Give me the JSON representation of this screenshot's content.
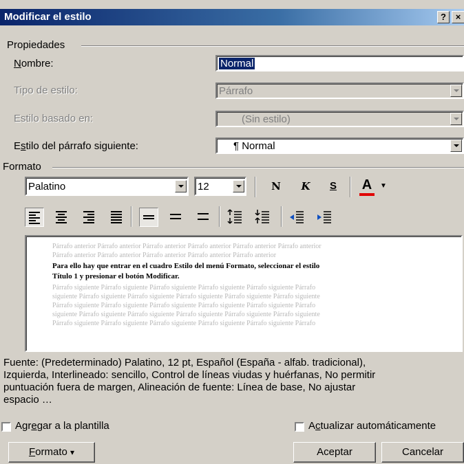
{
  "window": {
    "title": "Modificar el estilo",
    "help_glyph": "?",
    "close_glyph": "×"
  },
  "properties": {
    "group_label": "Propiedades",
    "name_label_prefix": "",
    "name_label_u": "N",
    "name_label_rest": "ombre:",
    "name_value": "Normal",
    "style_type_label": "Tipo de estilo:",
    "style_type_value": "Párrafo",
    "based_on_label": "Estilo basado en:",
    "based_on_value": "(Sin estilo)",
    "next_style_label_prefix": "E",
    "next_style_label_u": "s",
    "next_style_label_rest": "tilo del párrafo siguiente:",
    "next_style_value": "¶ Normal"
  },
  "format": {
    "group_label": "Formato",
    "font": "Palatino",
    "size": "12",
    "bold_glyph": "N",
    "italic_glyph": "K",
    "underline_glyph": "S",
    "font_color_glyph": "A",
    "font_color": "#e00000"
  },
  "preview": {
    "prev_line1": "Párrafo anterior Párrafo anterior Párrafo anterior Párrafo anterior Párrafo anterior Párrafo anterior",
    "prev_line2": "Párrafo anterior Párrafo anterior Párrafo anterior Párrafo anterior Párrafo anterior",
    "main_line1": "Para ello hay que entrar en el cuadro Estilo del menú Formato, seleccionar el estilo",
    "main_line2": "Título 1 y presionar el botón Modificar.",
    "next_line1": "Párrafo siguiente Párrafo siguiente Párrafo siguiente Párrafo siguiente Párrafo siguiente Párrafo",
    "next_line2": "siguiente Párrafo siguiente Párrafo siguiente Párrafo siguiente Párrafo siguiente Párrafo siguiente",
    "next_line3": "Párrafo siguiente Párrafo siguiente Párrafo siguiente Párrafo siguiente Párrafo siguiente Párrafo",
    "next_line4": "siguiente Párrafo siguiente Párrafo siguiente Párrafo siguiente Párrafo siguiente Párrafo siguiente",
    "next_line5": "Párrafo siguiente Párrafo siguiente Párrafo siguiente Párrafo siguiente Párrafo siguiente Párrafo"
  },
  "description": {
    "line1": "Fuente: (Predeterminado) Palatino, 12 pt, Español (España - alfab. tradicional),",
    "line2": "Izquierda, Interlineado:  sencillo, Control de líneas viudas y huérfanas, No permitir",
    "line3": "puntuación fuera de margen, Alineación de fuente: Línea de base, No ajustar",
    "line4": "espacio …"
  },
  "options": {
    "add_template_prefix": "Agr",
    "add_template_u": "e",
    "add_template_rest": "gar a la plantilla",
    "auto_update_prefix": "A",
    "auto_update_u": "c",
    "auto_update_rest": "tualizar automáticamente"
  },
  "buttons": {
    "format_u": "F",
    "format_rest": "ormato",
    "format_arrow": "▾",
    "accept": "Aceptar",
    "cancel": "Cancelar"
  }
}
